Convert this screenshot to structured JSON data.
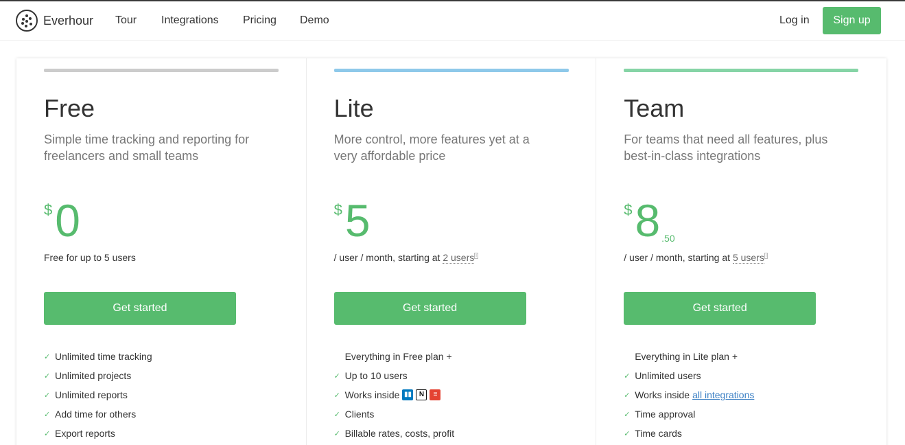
{
  "nav": {
    "brand": "Everhour",
    "links": [
      "Tour",
      "Integrations",
      "Pricing",
      "Demo"
    ],
    "login": "Log in",
    "signup": "Sign up"
  },
  "colors": {
    "accent": "#57bb6e",
    "free_bar": "#cccccc",
    "lite_bar": "#8ec9ea",
    "team_bar": "#86d4a6",
    "link": "#3a7fc4"
  },
  "plans": [
    {
      "name": "Free",
      "description": "Simple time tracking and reporting for freelancers and small teams",
      "currency": "$",
      "price": "0",
      "cents": "",
      "note_prefix": "Free for up to 5 users",
      "note_link": "",
      "cta": "Get started",
      "features_intro": "",
      "features": [
        "Unlimited time tracking",
        "Unlimited projects",
        "Unlimited reports",
        "Add time for others",
        "Export reports"
      ]
    },
    {
      "name": "Lite",
      "description": "More control, more features yet at a very affordable price",
      "currency": "$",
      "price": "5",
      "cents": "",
      "note_prefix": "/ user / month, starting at",
      "note_link": "2 users",
      "note_sup": "i",
      "cta": "Get started",
      "features_intro": "Everything in Free plan +",
      "features": [
        "Up to 10 users",
        "Works inside",
        "Clients",
        "Billable rates, costs, profit"
      ],
      "integration_icons": [
        {
          "icon": "trello-icon",
          "color": "#0079bf",
          "glyph": "▮▮"
        },
        {
          "icon": "notion-icon",
          "color": "#111111",
          "glyph": "N"
        },
        {
          "icon": "todoist-icon",
          "color": "#e44332",
          "glyph": "≡"
        }
      ]
    },
    {
      "name": "Team",
      "description": "For teams that need all features, plus best-in-class integrations",
      "currency": "$",
      "price": "8",
      "cents": ".50",
      "note_prefix": "/ user / month, starting at",
      "note_link": "5 users",
      "note_sup": "i",
      "cta": "Get started",
      "features_intro": "Everything in Lite plan +",
      "features": [
        "Unlimited users",
        "Works inside",
        "Time approval",
        "Time cards"
      ],
      "works_inside_link": "all integrations"
    }
  ]
}
